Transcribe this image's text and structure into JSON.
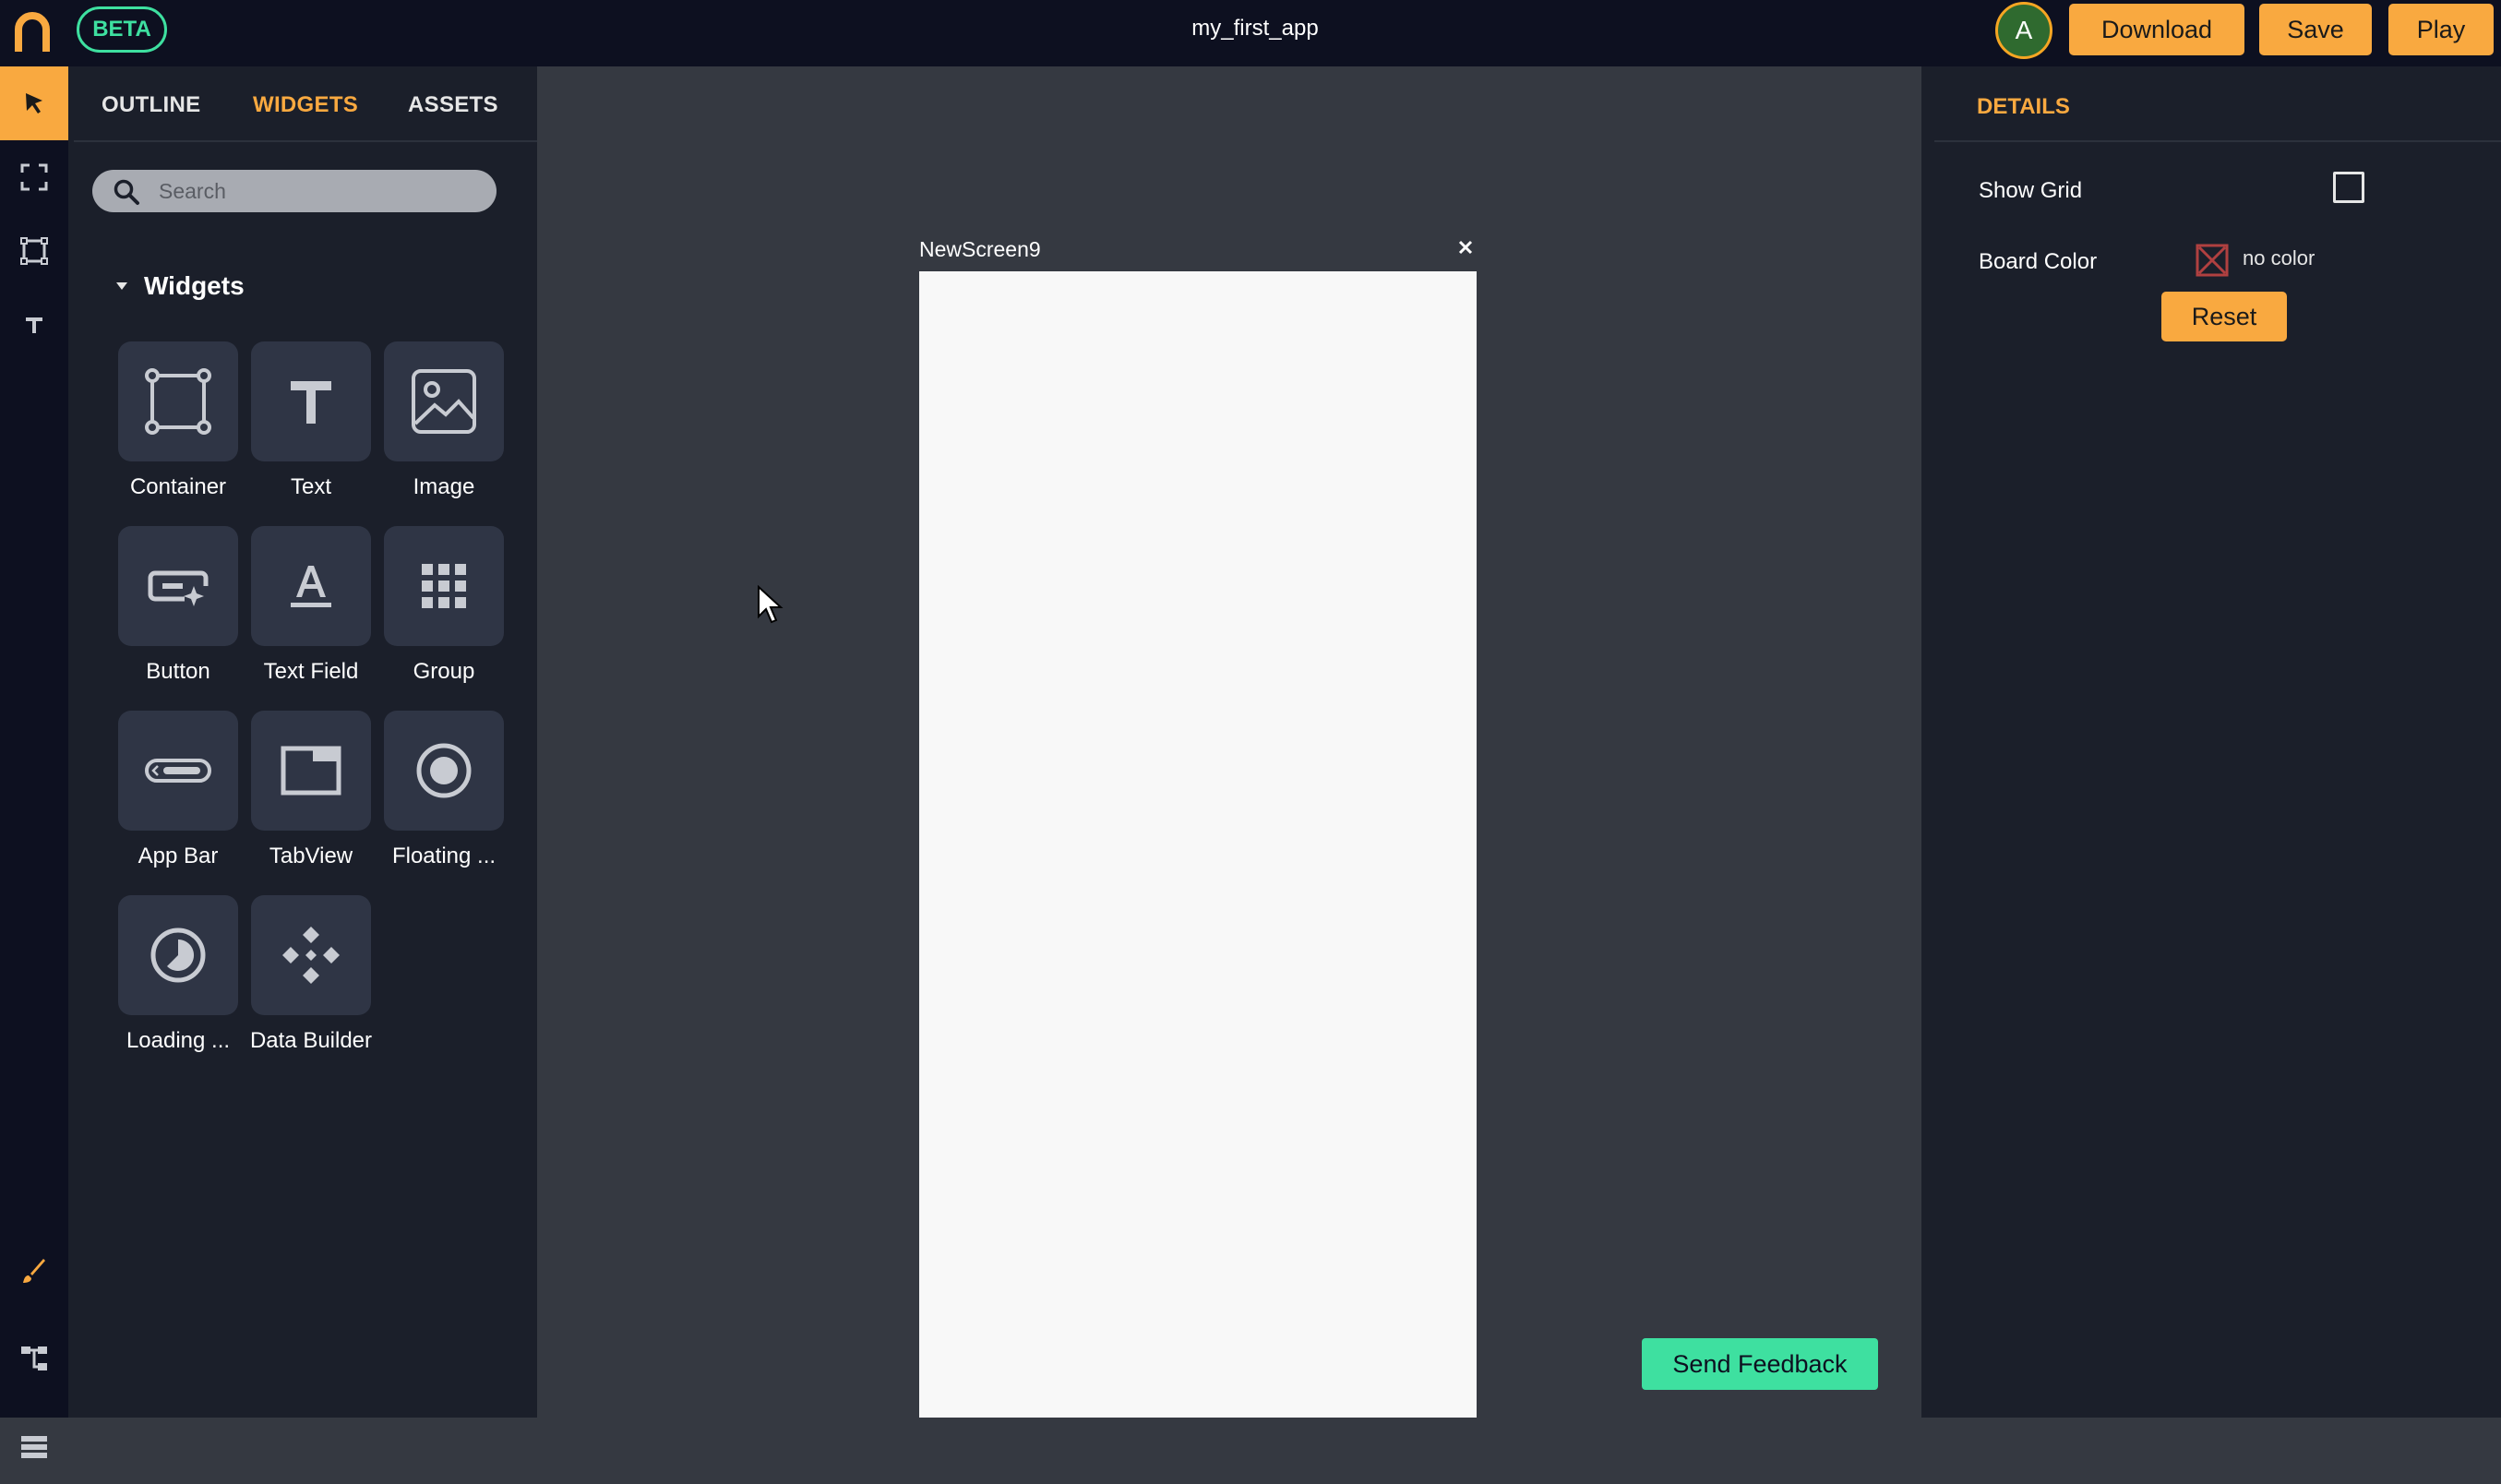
{
  "header": {
    "beta_label": "BETA",
    "app_title": "my_first_app",
    "avatar_initial": "A",
    "download_label": "Download",
    "save_label": "Save",
    "play_label": "Play"
  },
  "rail": {
    "items": [
      "select-icon",
      "frame-icon",
      "container-icon",
      "text-tool-icon",
      "brush-icon",
      "tree-icon",
      "list-icon"
    ]
  },
  "left_panel": {
    "tabs": [
      "OUTLINE",
      "WIDGETS",
      "ASSETS"
    ],
    "active_tab": "WIDGETS",
    "search": {
      "placeholder": "Search",
      "value": ""
    },
    "section_title": "Widgets",
    "widgets": [
      {
        "label": "Container",
        "icon": "container-icon"
      },
      {
        "label": "Text",
        "icon": "text-icon"
      },
      {
        "label": "Image",
        "icon": "image-icon"
      },
      {
        "label": "Button",
        "icon": "button-icon"
      },
      {
        "label": "Text Field",
        "icon": "text-field-icon"
      },
      {
        "label": "Group",
        "icon": "grid-icon"
      },
      {
        "label": "App Bar",
        "icon": "app-bar-icon"
      },
      {
        "label": "TabView",
        "icon": "tabview-icon"
      },
      {
        "label": "Floating ...",
        "icon": "floating-button-icon"
      },
      {
        "label": "Loading ...",
        "icon": "loading-icon"
      },
      {
        "label": "Data Builder",
        "icon": "data-builder-icon"
      }
    ]
  },
  "canvas": {
    "screen_name": "NewScreen9",
    "feedback_label": "Send Feedback"
  },
  "details": {
    "title": "DETAILS",
    "show_grid_label": "Show Grid",
    "show_grid_checked": false,
    "board_color_label": "Board Color",
    "board_color_value": "no color",
    "reset_label": "Reset"
  },
  "colors": {
    "accent": "#f9a940",
    "beta": "#3ee0a0",
    "topbar": "#0d1020",
    "panel": "#1b1f2a",
    "canvas": "#353941"
  }
}
